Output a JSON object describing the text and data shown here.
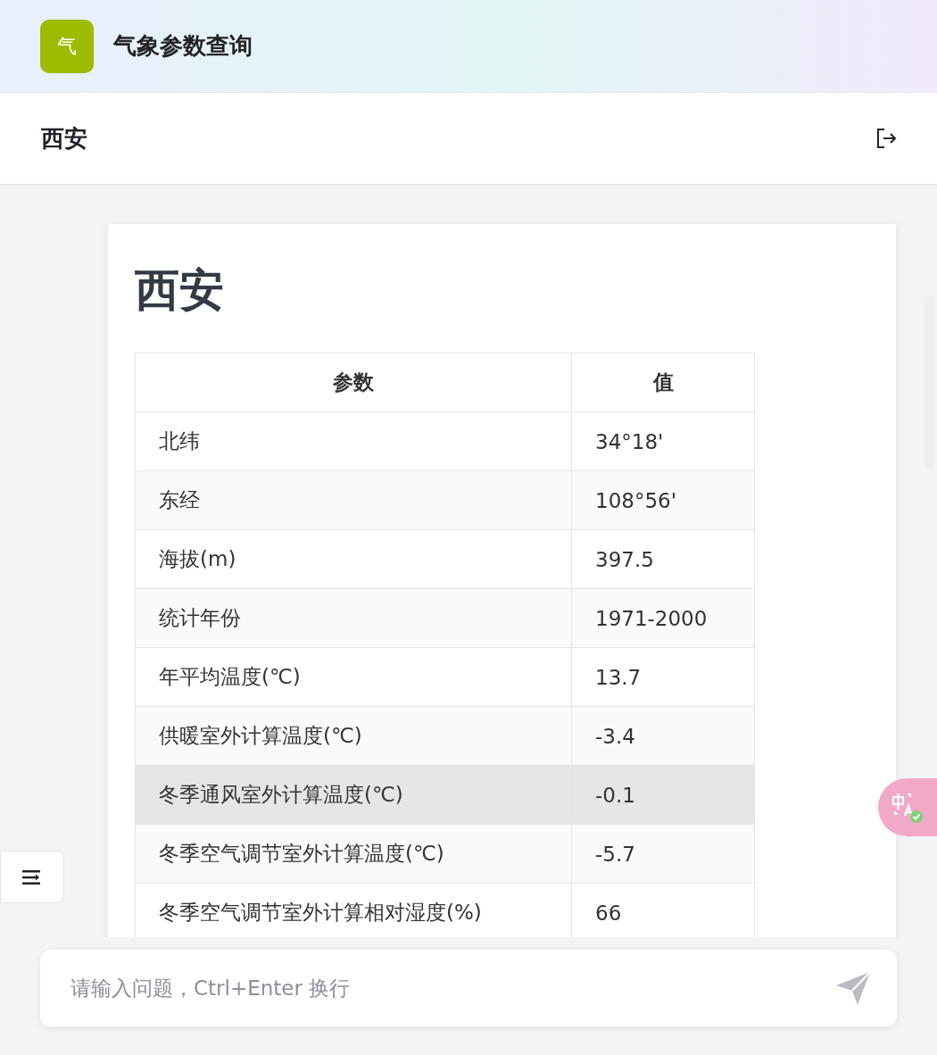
{
  "app": {
    "logo_text": "气",
    "title": "气象参数查询"
  },
  "location_bar": {
    "title": "西安"
  },
  "document": {
    "heading": "西安",
    "table": {
      "columns": [
        "参数",
        "值"
      ],
      "rows": [
        {
          "cells": [
            "北纬",
            "34°18'"
          ],
          "highlighted": false
        },
        {
          "cells": [
            "东经",
            "108°56'"
          ],
          "highlighted": false
        },
        {
          "cells": [
            "海拔(m)",
            "397.5"
          ],
          "highlighted": false
        },
        {
          "cells": [
            "统计年份",
            "1971-2000"
          ],
          "highlighted": false
        },
        {
          "cells": [
            "年平均温度(℃)",
            "13.7"
          ],
          "highlighted": false
        },
        {
          "cells": [
            "供暖室外计算温度(℃)",
            "-3.4"
          ],
          "highlighted": false
        },
        {
          "cells": [
            "冬季通风室外计算温度(℃)",
            "-0.1"
          ],
          "highlighted": true
        },
        {
          "cells": [
            "冬季空气调节室外计算温度(℃)",
            "-5.7"
          ],
          "highlighted": false
        },
        {
          "cells": [
            "冬季空气调节室外计算相对湿度(%)",
            "66"
          ],
          "highlighted": false
        }
      ]
    }
  },
  "input": {
    "placeholder": "请输入问题，Ctrl+Enter 换行"
  }
}
